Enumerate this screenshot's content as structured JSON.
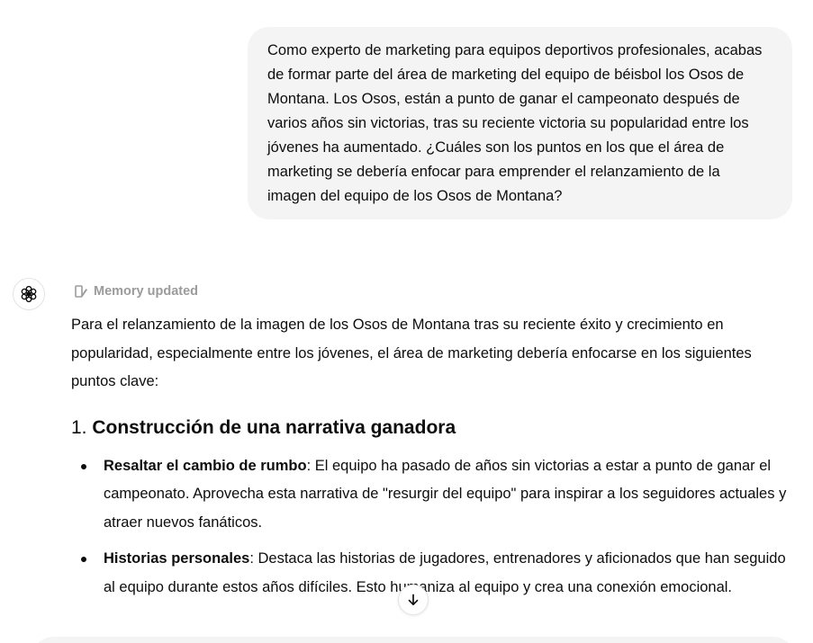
{
  "user_message": {
    "text": "Como experto de marketing para equipos deportivos profesionales, acabas de formar parte del área de marketing del equipo de béisbol los Osos de Montana. Los Osos, están a punto de ganar el campeonato después de varios años sin victorias, tras su reciente victoria su popularidad entre los jóvenes ha aumentado. ¿Cuáles son los puntos en los que el área de marketing se debería enfocar para emprender el relanzamiento de la imagen del equipo de los Osos de Montana?"
  },
  "assistant": {
    "avatar_icon": "openai-logo-icon",
    "memory_status": "Memory updated",
    "memory_icon": "memory-pencil-icon",
    "intro": "Para el relanzamiento de la imagen de los Osos de Montana tras su reciente éxito y crecimiento en popularidad, especialmente entre los jóvenes, el área de marketing debería enfocarse en los siguientes puntos clave:",
    "section": {
      "number": "1.",
      "title": "Construcción de una narrativa ganadora"
    },
    "points": [
      {
        "label": "Resaltar el cambio de rumbo",
        "text": ": El equipo ha pasado de años sin victorias a estar a punto de ganar el campeonato. Aprovecha esta narrativa de \"resurgir del equipo\" para inspirar a los seguidores actuales y atraer nuevos fanáticos."
      },
      {
        "label": "Historias personales",
        "text": ": Destaca las historias de jugadores, entrenadores y aficionados que han seguido al equipo durante estos años difíciles. Esto humaniza al equipo y crea una conexión emocional."
      }
    ]
  },
  "scroll_button_icon": "arrow-down-icon"
}
